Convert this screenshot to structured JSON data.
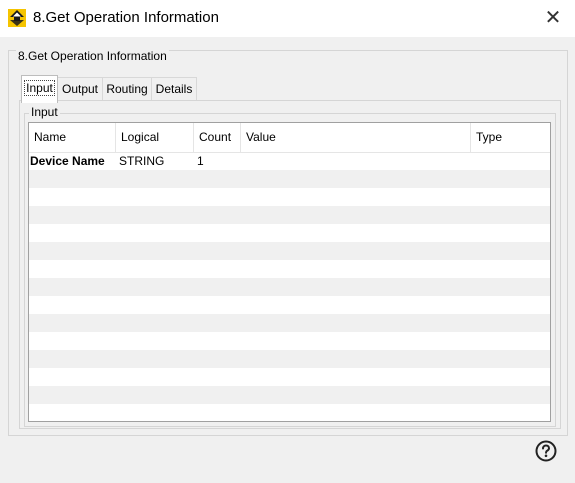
{
  "window": {
    "title": "8.Get Operation Information",
    "close_glyph": "✕"
  },
  "group_title": "8.Get Operation Information",
  "tabs": [
    {
      "label": "Input",
      "active": true
    },
    {
      "label": "Output",
      "active": false
    },
    {
      "label": "Routing",
      "active": false
    },
    {
      "label": "Details",
      "active": false
    }
  ],
  "panel": {
    "group_title": "Input",
    "table": {
      "columns": [
        "Name",
        "Logical",
        "Count",
        "Value",
        "Type"
      ],
      "rows": [
        {
          "name": "Device Name",
          "logical": "STRING",
          "count": "1",
          "value": "",
          "type": ""
        }
      ]
    }
  },
  "icons": {
    "app": "app-logo-icon",
    "help": "help-icon",
    "close": "close-icon"
  },
  "colors": {
    "logo_yellow": "#f5c400",
    "logo_dark": "#1a1a1a",
    "row_alt": "#f0f0f0",
    "dialog_bg": "#f0f0f0"
  }
}
